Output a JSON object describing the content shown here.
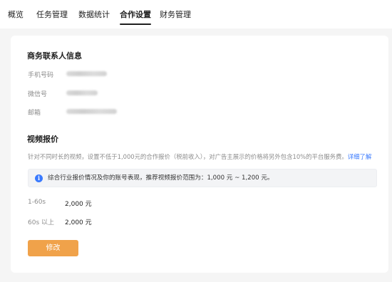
{
  "tabs": [
    {
      "label": "概览"
    },
    {
      "label": "任务管理"
    },
    {
      "label": "数据统计"
    },
    {
      "label": "合作设置",
      "active": true
    },
    {
      "label": "财务管理"
    }
  ],
  "contact": {
    "title": "商务联系人信息",
    "phone_label": "手机号码",
    "wechat_label": "微信号",
    "email_label": "邮箱"
  },
  "pricing": {
    "title": "视频报价",
    "description": "针对不同时长的视频，设置不低于1,000元的合作报价（税前收入），对广告主展示的价格将另外包含10%的平台服务费。",
    "learn_more": "详细了解",
    "notice_icon": "info-icon",
    "notice": "综合行业报价情况及你的账号表现，推荐视频报价范围为：1,000 元 ~ 1,200 元。",
    "rows": [
      {
        "label": "1-60s",
        "value": "2,000 元"
      },
      {
        "label": "60s 以上",
        "value": "2,000 元"
      }
    ],
    "edit_label": "修改"
  },
  "colors": {
    "accent_button": "#f0a24a",
    "link": "#3a7afe",
    "info_icon": "#3a7afe"
  }
}
